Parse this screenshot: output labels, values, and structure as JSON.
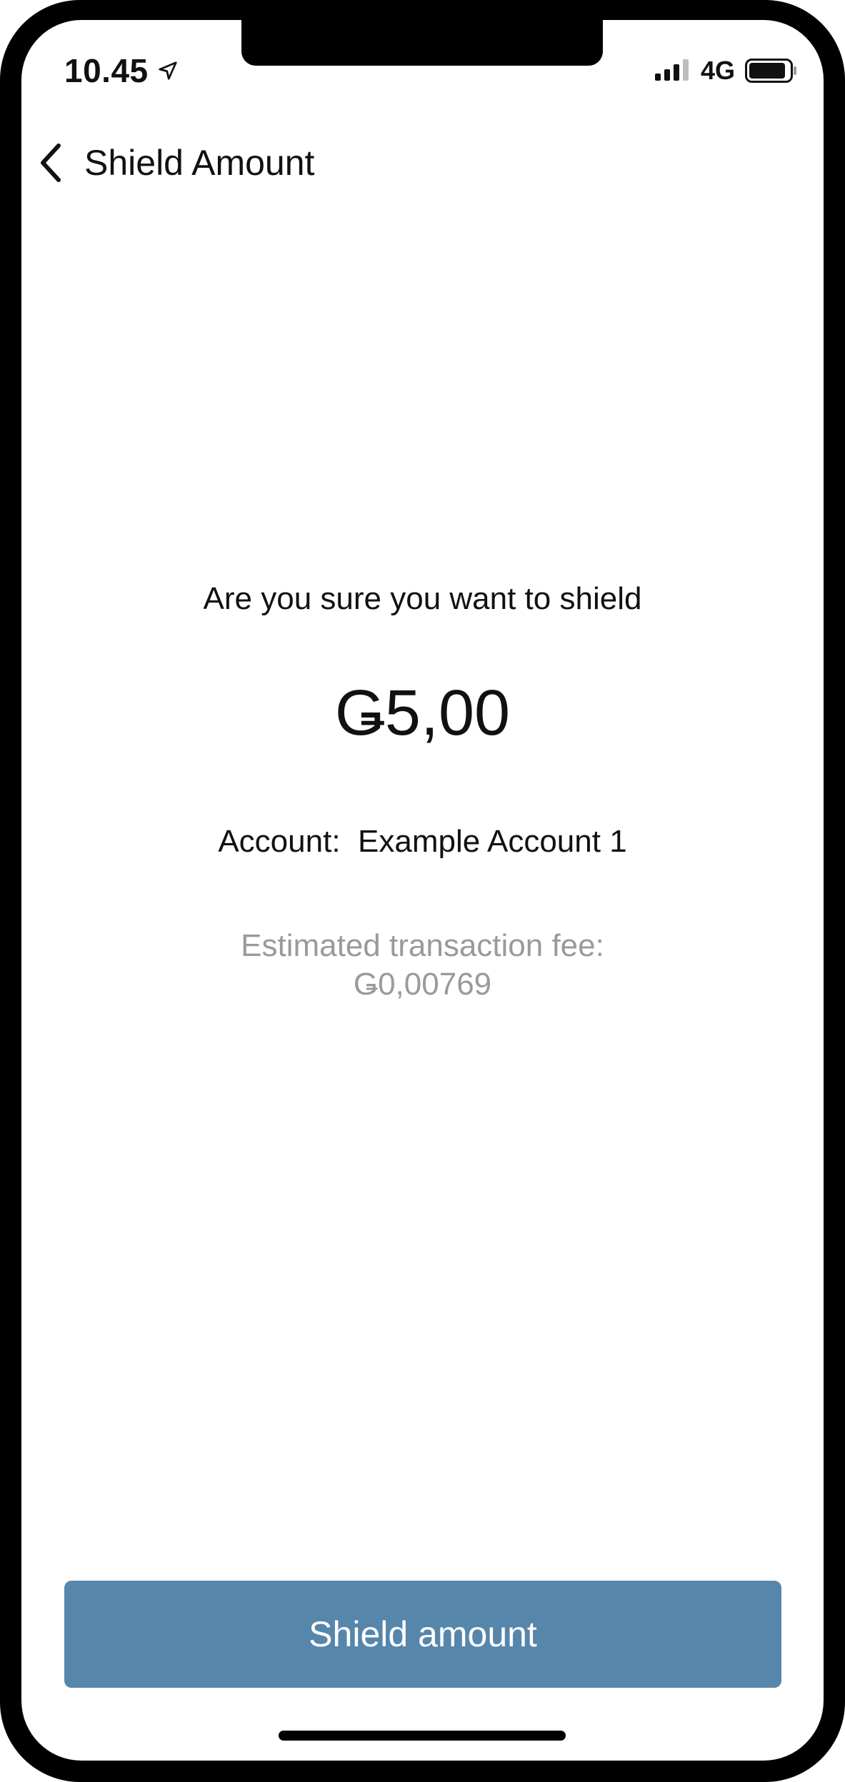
{
  "status_bar": {
    "time": "10.45",
    "network": "4G",
    "icons": [
      "location-arrow-icon",
      "signal-icon",
      "battery-icon"
    ]
  },
  "header": {
    "title": "Shield Amount",
    "back_icon": "chevron-left-icon"
  },
  "confirm": {
    "prompt": "Are you sure you want to shield",
    "amount": "Ǥ5,00",
    "account_label": "Account:",
    "account_name": "Example Account 1",
    "fee_label": "Estimated transaction fee:",
    "fee_value": "Ǥ0,00769"
  },
  "actions": {
    "shield_label": "Shield amount"
  },
  "colors": {
    "button": "#5786ab",
    "fee_text": "#9a9a9a",
    "text": "#111111"
  }
}
